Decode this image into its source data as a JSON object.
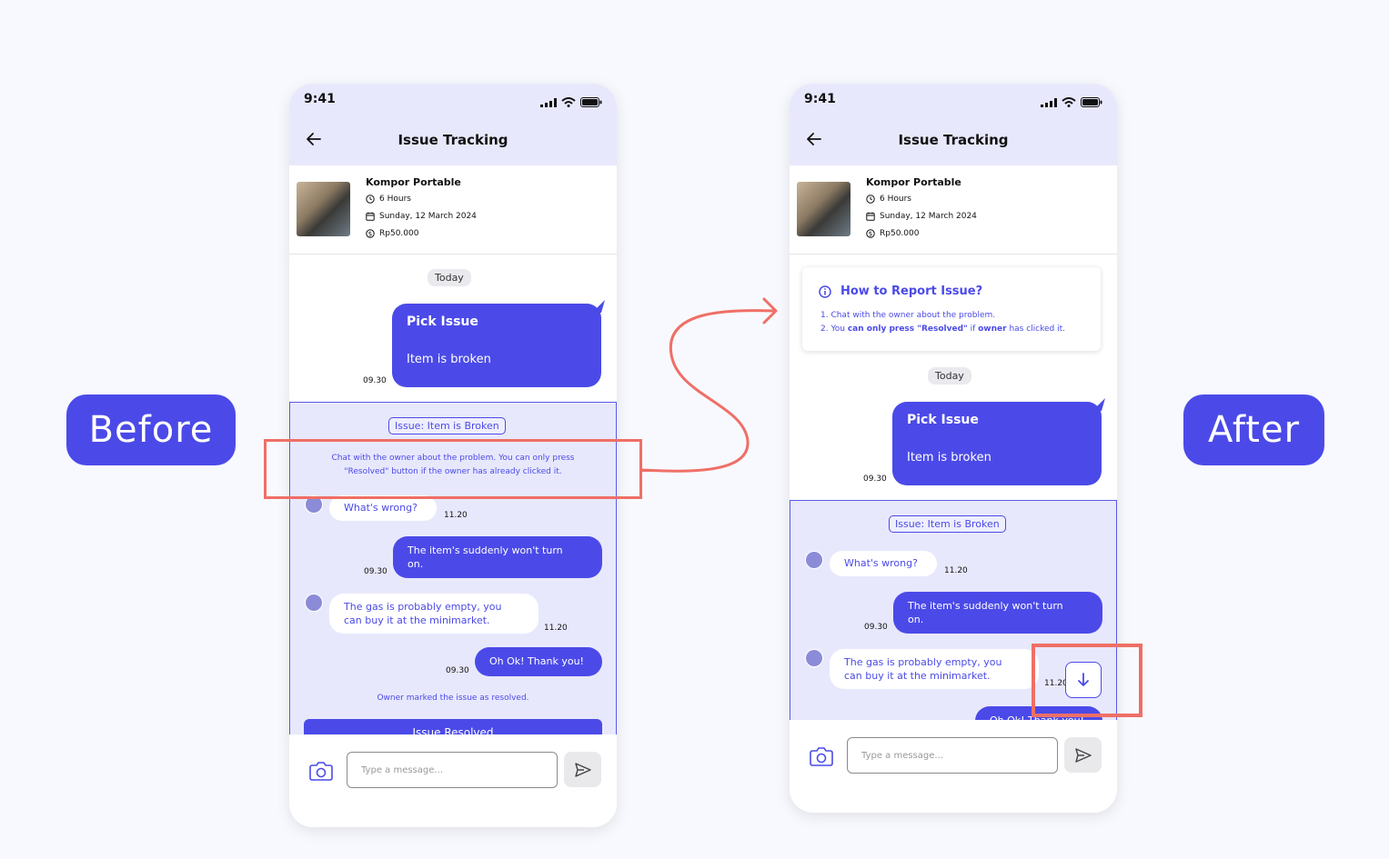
{
  "labels": {
    "before": "Before",
    "after": "After"
  },
  "screen": {
    "time": "9:41",
    "title": "Issue Tracking",
    "product": {
      "name": "Kompor Portable",
      "duration": "6 Hours",
      "date": "Sunday, 12 March 2024",
      "price": "Rp50.000"
    },
    "date_chip": "Today",
    "pick_issue": {
      "title": "Pick Issue",
      "body": "Item is broken",
      "time": "09.30"
    },
    "issue_chip": "Issue: Item is Broken",
    "issue_note_line1": "Chat with the owner about the problem. You can only press",
    "issue_note_line2": "\"Resolved\" button if the owner has already clicked it.",
    "messages": {
      "m1": {
        "text": "What's wrong?",
        "time": "11.20"
      },
      "m2a": {
        "text": "The item's suddenly won't turn",
        "text2": "on.",
        "time": "09.30"
      },
      "m3": {
        "text": "The gas is probably empty, you",
        "text2": "can buy it at the minimarket.",
        "time": "11.20"
      },
      "m4": {
        "text": "Oh Ok! Thank you!",
        "time": "09.30"
      }
    },
    "resolved_note": "Owner marked the issue as resolved.",
    "resolved_button": "Issue Resolved",
    "input_placeholder": "Type a message...",
    "guide": {
      "title": "How to Report Issue?",
      "step1": "1. Chat with the owner about the problem.",
      "step2_pre": "2. You ",
      "step2_b1": "can only press \"Resolved\"",
      "step2_mid": " if ",
      "step2_b2": "owner",
      "step2_post": " has clicked it."
    }
  },
  "colors": {
    "accent": "#4b4ae8",
    "highlight": "#ef6f66",
    "header_bg": "#e8e8fd"
  },
  "icons": [
    "back-arrow-icon",
    "signal-icon",
    "wifi-icon",
    "battery-icon",
    "clock-icon",
    "calendar-icon",
    "dollar-icon",
    "camera-icon",
    "send-icon",
    "info-icon",
    "arrow-down-icon",
    "curved-arrow-icon"
  ]
}
